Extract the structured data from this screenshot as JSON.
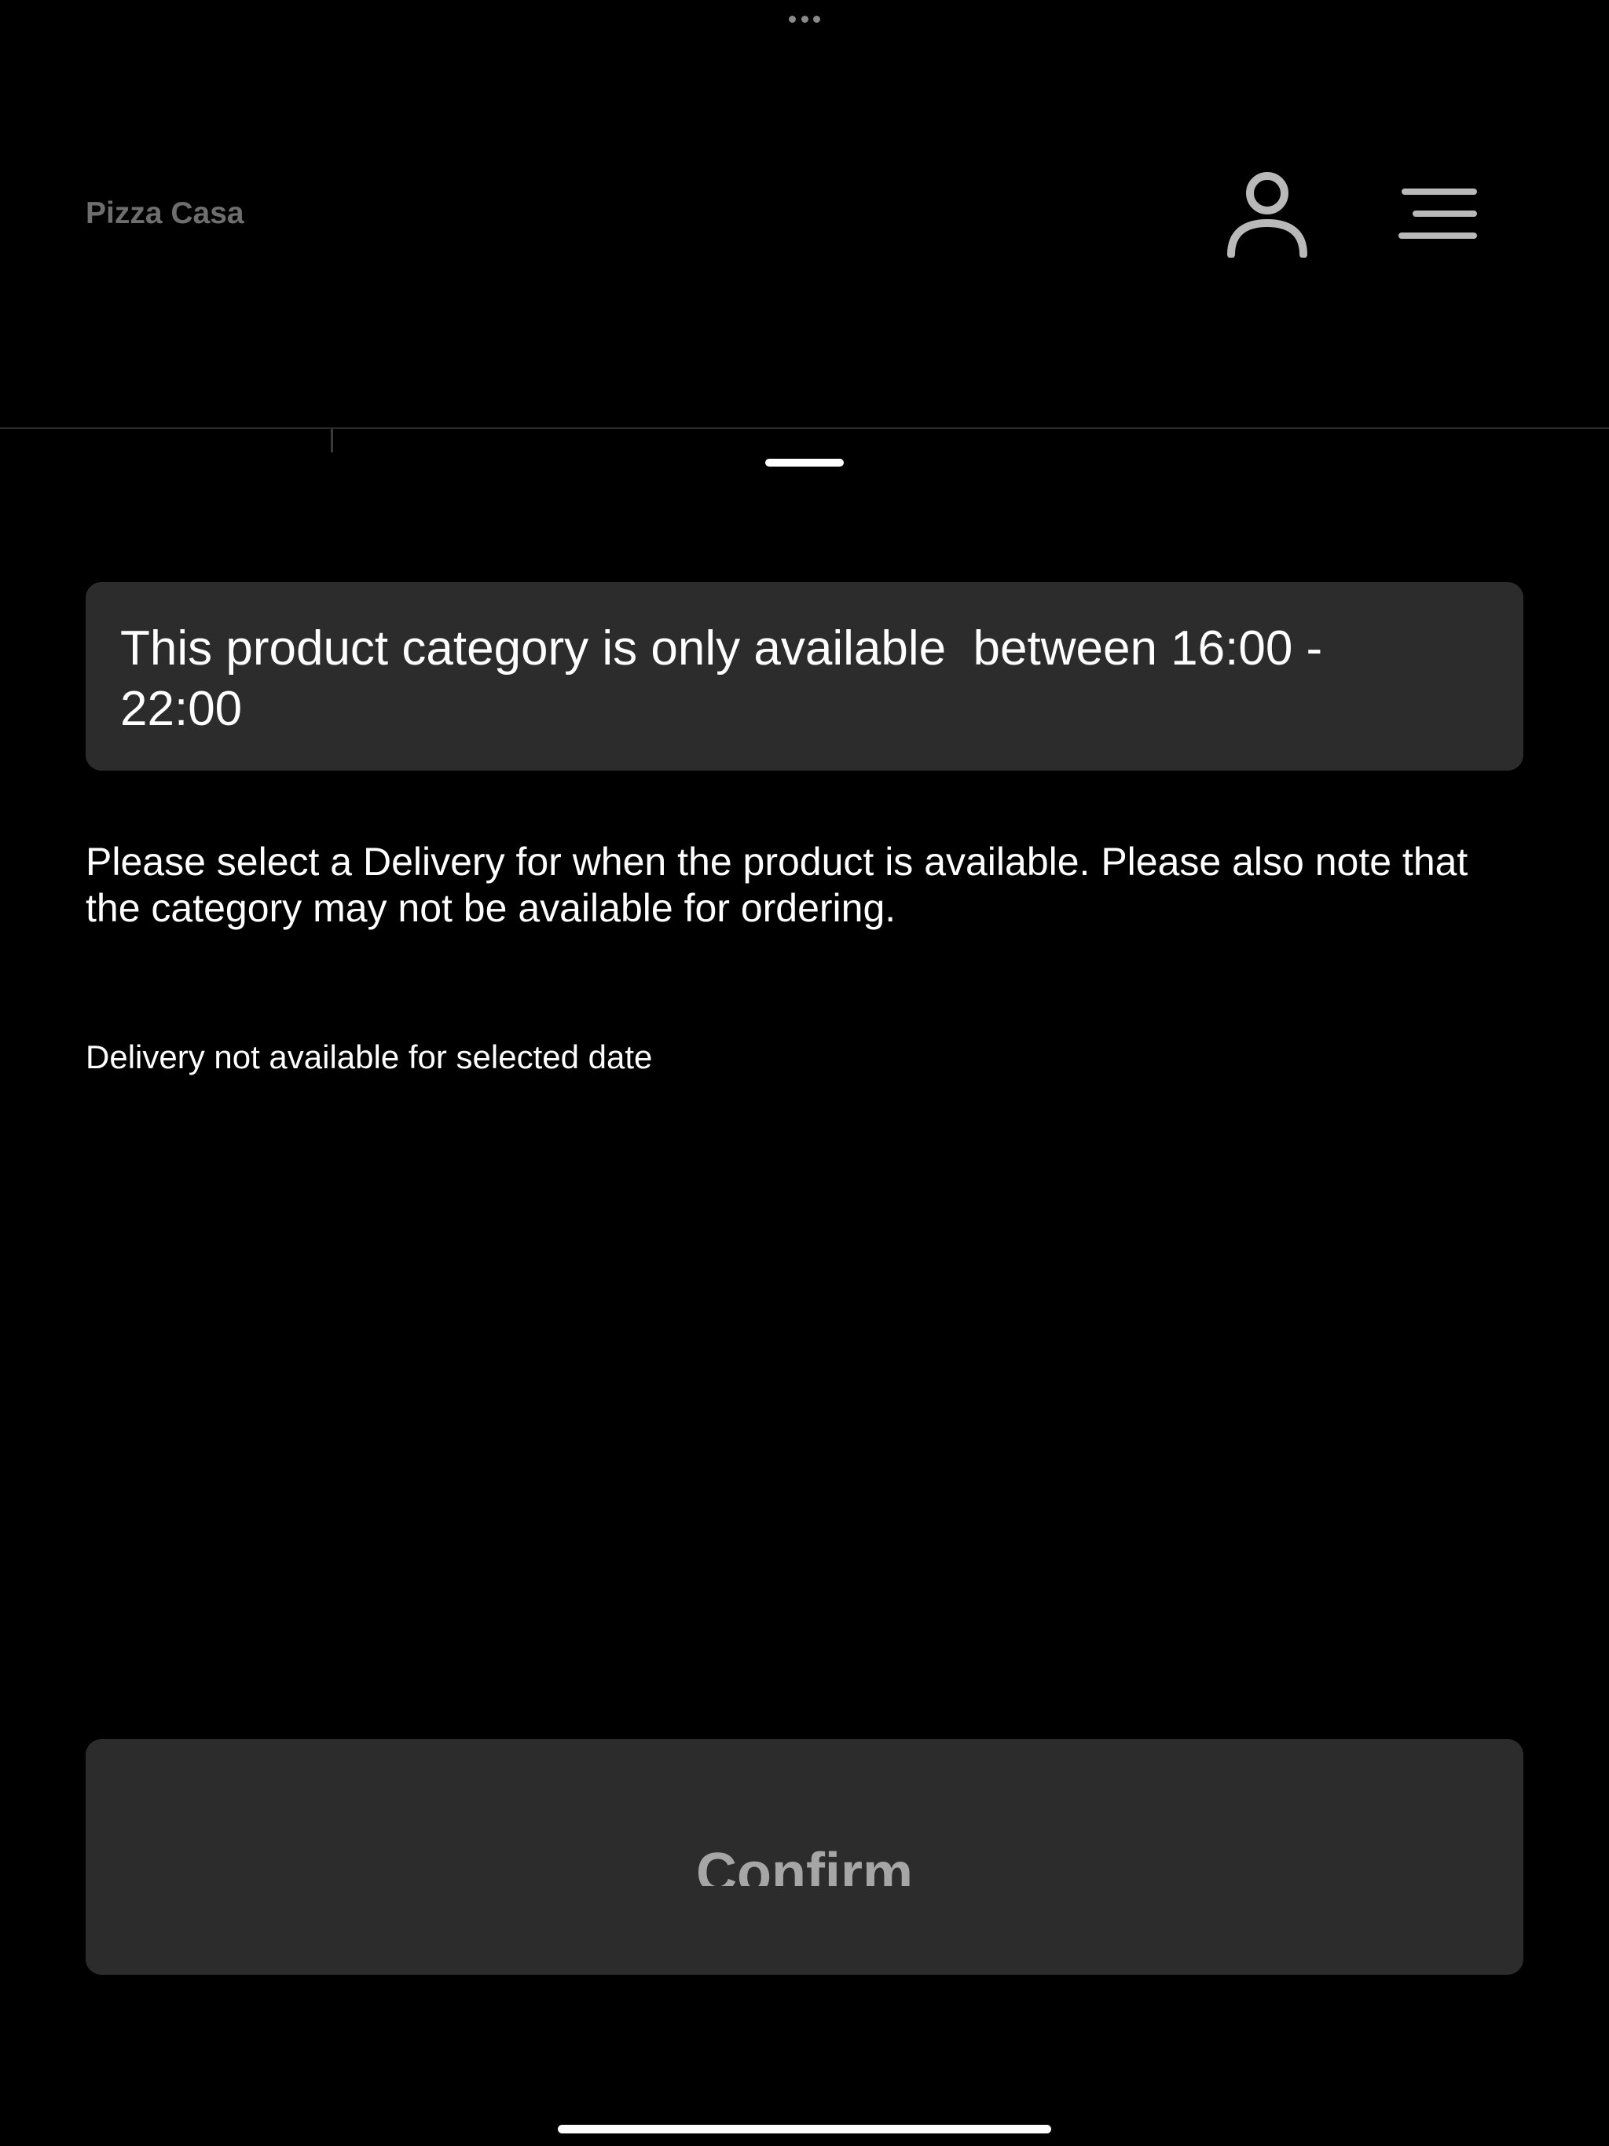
{
  "header": {
    "brand": "Pizza Casa",
    "profile_icon": "user-outline-icon",
    "menu_icon": "hamburger-menu-icon"
  },
  "notice": {
    "availability_message": "This product category is only available  between 16:00 -\n22:00",
    "instructions": "Please select a Delivery for when the product is available. Please also note that the category may not be available for ordering.",
    "delivery_status": "Delivery not available for selected date"
  },
  "actions": {
    "confirm_label": "Confirm"
  },
  "colors": {
    "background": "#000000",
    "card": "#2c2c2c",
    "brand_text": "#6e6e6e",
    "icon": "#b9b9b9",
    "button_text": "#a6a6a6"
  }
}
